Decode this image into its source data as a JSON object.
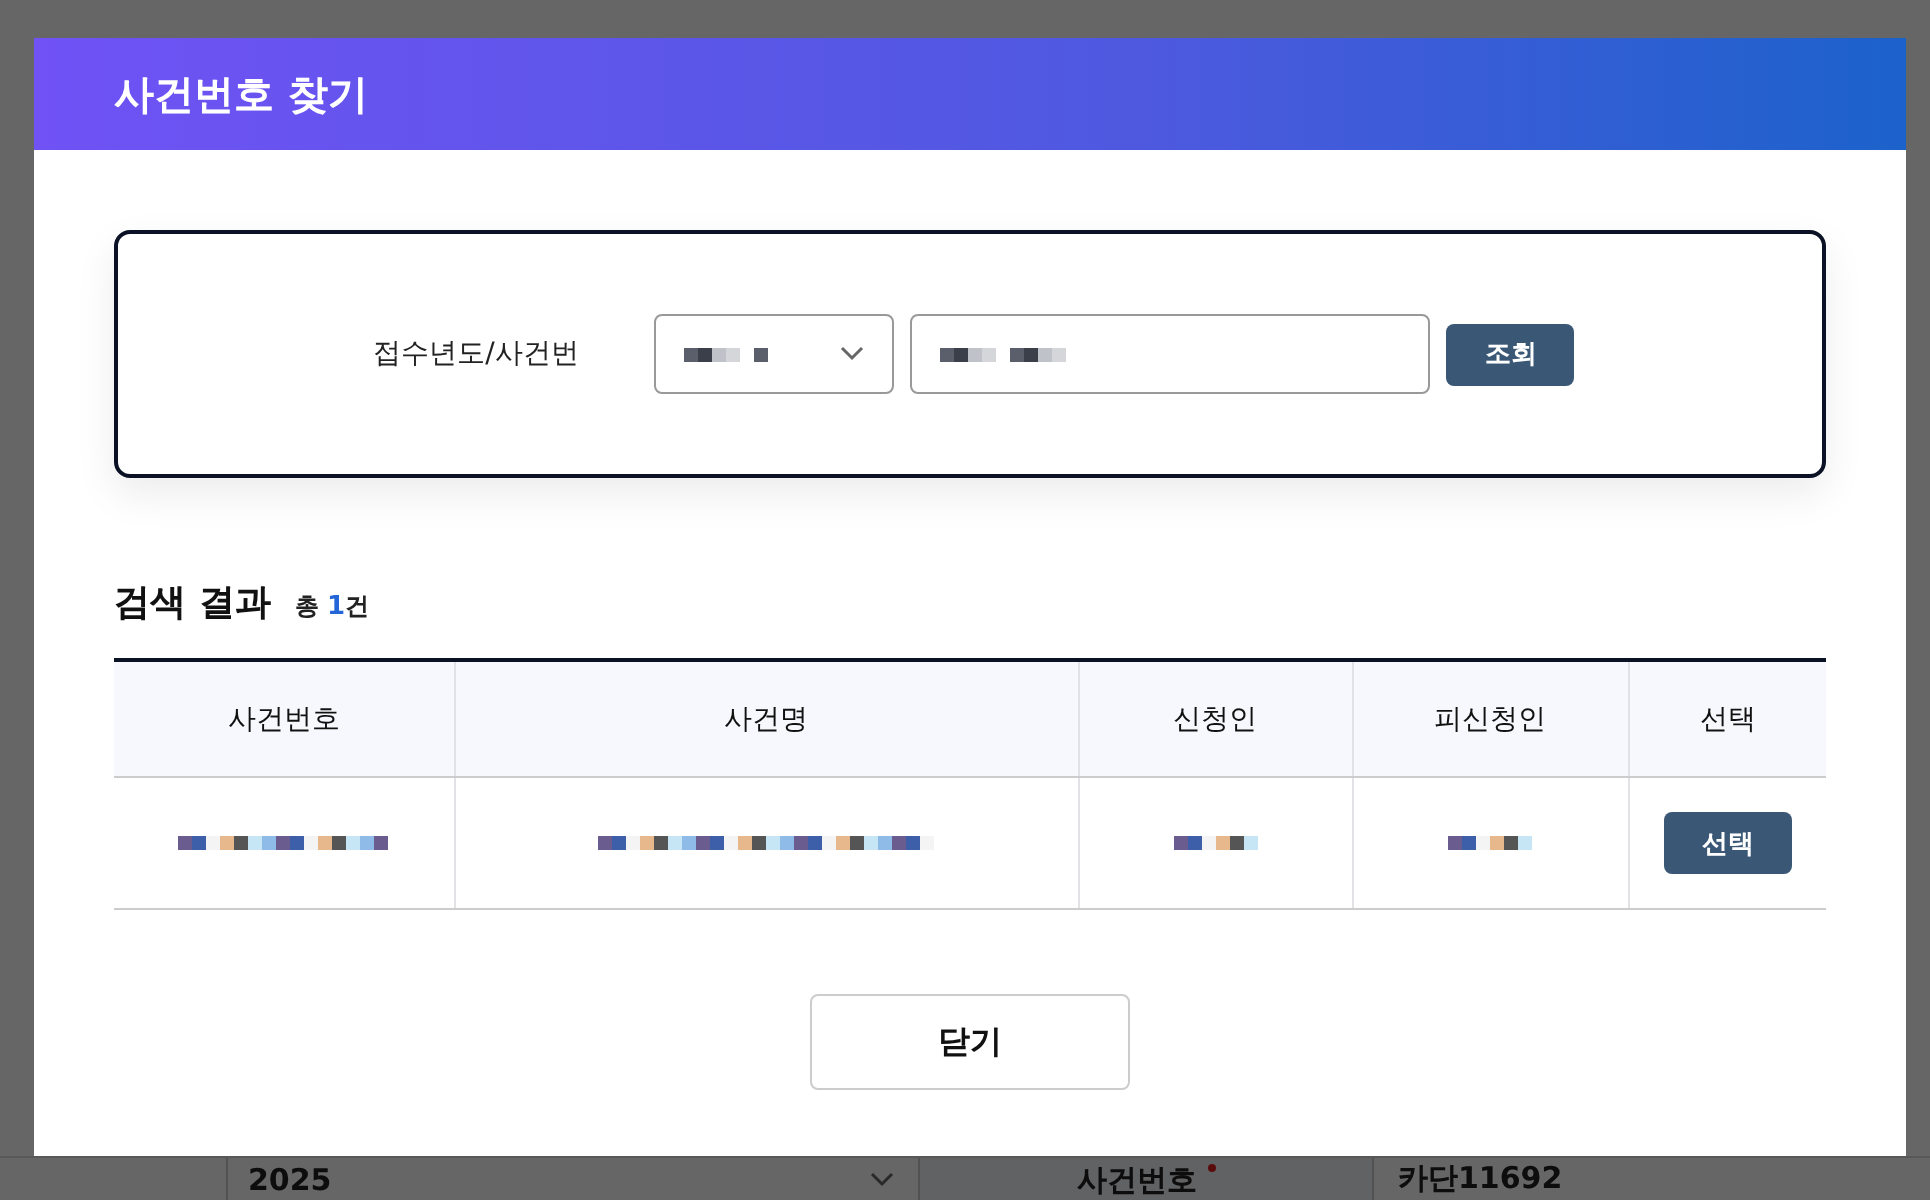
{
  "background_row": {
    "year_value": "2025",
    "case_label": "사건번호",
    "case_required": true,
    "case_value": "카단11692"
  },
  "dialog": {
    "title": "사건번호 찾기",
    "search": {
      "label": "접수년도/사건번",
      "button": "조회"
    },
    "results": {
      "title": "검색 결과",
      "count_prefix": "총",
      "count": "1",
      "count_suffix": "건",
      "columns": [
        "사건번호",
        "사건명",
        "신청인",
        "피신청인",
        "선택"
      ],
      "rows": [
        {
          "action": "선택"
        }
      ]
    },
    "close_button": "닫기"
  }
}
